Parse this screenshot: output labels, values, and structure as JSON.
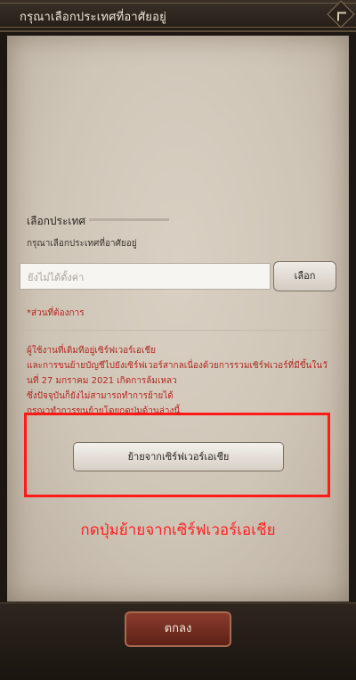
{
  "header": {
    "title": "กรุณาเลือกประเทศที่อาศัยอยู่",
    "back_icon": "diamond-back-icon"
  },
  "form": {
    "country_label": "เลือกประเทศ",
    "country_sublabel": "กรุณาเลือกประเทศที่อาศัยอยู่",
    "country_input_placeholder": "ยังไม่ได้ตั้งค่า",
    "select_button_label": "เลือก",
    "required_note": "*ส่วนที่ต้องการ"
  },
  "notice": {
    "lines": [
      "ผู้ใช้งานที่เดิมทีอยู่เซิร์ฟเวอร์เอเชีย",
      "และการขนย้ายบัญชีไปยังเซิร์ฟเวอร์สากลเนื่องด้วยการรวมเซิร์ฟเวอร์ที่มีขึ้นในวั",
      "นที่ 27 มกราคม 2021 เกิดการล้มเหลว",
      "ซึ่งปัจจุบันก็ยังไม่สามารถทำการย้ายได้",
      "กรุณาทำการขนย้ายโดยกดปุ่มด้านล่างนี้"
    ]
  },
  "move_button_label": "ย้ายจากเซิร์ฟเวอร์เอเชีย",
  "instruction": "กดปุ่มย้ายจากเซิร์ฟเวอร์เอเชีย",
  "footer": {
    "ok_label": "ตกลง"
  },
  "colors": {
    "highlight": "#ff1a1a",
    "notice_text": "#b3261e",
    "ok_button": "#6e281d"
  }
}
